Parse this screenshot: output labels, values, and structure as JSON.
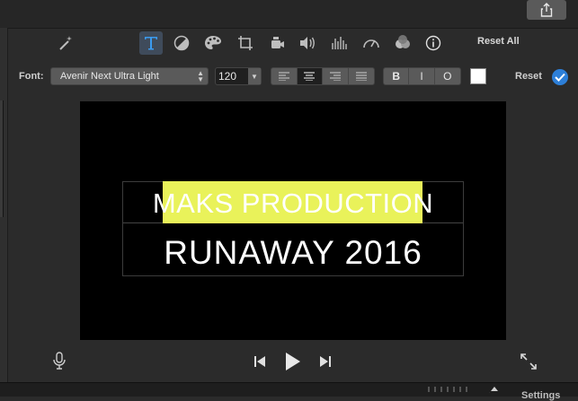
{
  "toolbar": {
    "icons": [
      "magic-wand-icon",
      "text-icon",
      "color-balance-icon",
      "color-palette-icon",
      "crop-icon",
      "camera-stabilization-icon",
      "volume-icon",
      "equalizer-icon",
      "speed-icon",
      "filters-icon",
      "info-icon"
    ],
    "active_icon": "text-icon",
    "reset_all_label": "Reset All"
  },
  "font_row": {
    "font_label": "Font:",
    "font_name": "Avenir Next Ultra Light",
    "font_size": "120",
    "bold_label": "B",
    "italic_label": "I",
    "outline_label": "O",
    "text_color": "#ffffff",
    "reset_label": "Reset",
    "alignment_selected": "center"
  },
  "viewer": {
    "title_line_1": "MAKS PRODUCTION",
    "title_line_2": "RUNAWAY 2016",
    "highlight_color": "#e9f25a"
  },
  "bottom": {
    "settings_label": "Settings"
  },
  "colors": {
    "accent": "#2d7fd8",
    "background": "#2b2b2b"
  }
}
